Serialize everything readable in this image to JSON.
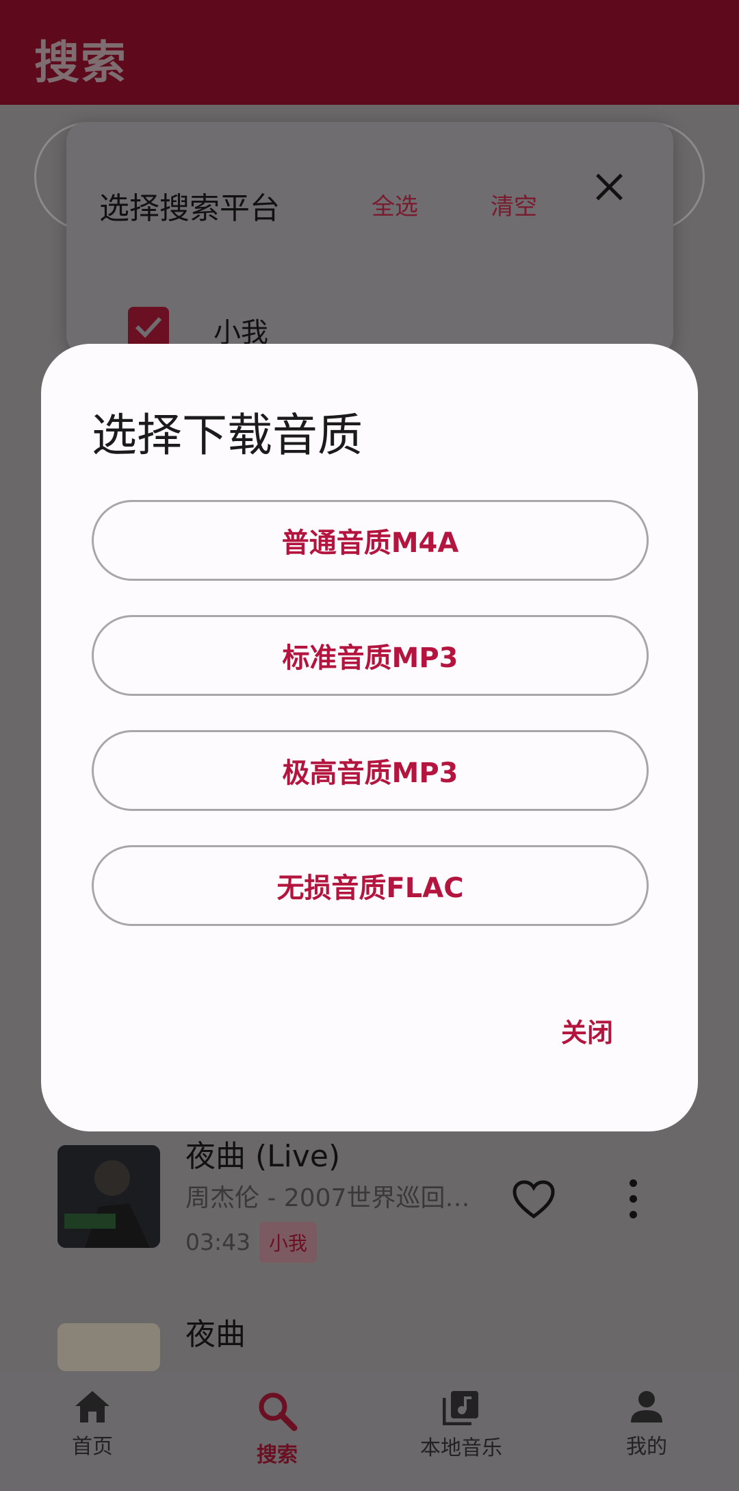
{
  "header": {
    "title": "搜索"
  },
  "platform_panel": {
    "title": "选择搜索平台",
    "select_all": "全选",
    "clear": "清空",
    "items": [
      {
        "label": "小我",
        "checked": true
      }
    ]
  },
  "songs": [
    {
      "title": "夜曲 (Live)",
      "subtitle": "周杰伦 - 2007世界巡回…",
      "duration": "03:43",
      "tag": "小我"
    },
    {
      "title": "夜曲"
    }
  ],
  "dialog": {
    "title": "选择下载音质",
    "options": [
      {
        "label": "普通音质M4A"
      },
      {
        "label": "标准音质MP3"
      },
      {
        "label": "极高音质MP3"
      },
      {
        "label": "无损音质FLAC"
      }
    ],
    "close": "关闭"
  },
  "nav": {
    "items": [
      {
        "label": "首页",
        "icon": "home-icon",
        "active": false
      },
      {
        "label": "搜索",
        "icon": "search-icon",
        "active": true
      },
      {
        "label": "本地音乐",
        "icon": "music-library-icon",
        "active": false
      },
      {
        "label": "我的",
        "icon": "person-icon",
        "active": false
      }
    ]
  },
  "colors": {
    "accent": "#b3153e",
    "header_bg": "#5e0a1c",
    "scrim": "#6a6869",
    "dialog_bg": "#fdfbfd"
  }
}
